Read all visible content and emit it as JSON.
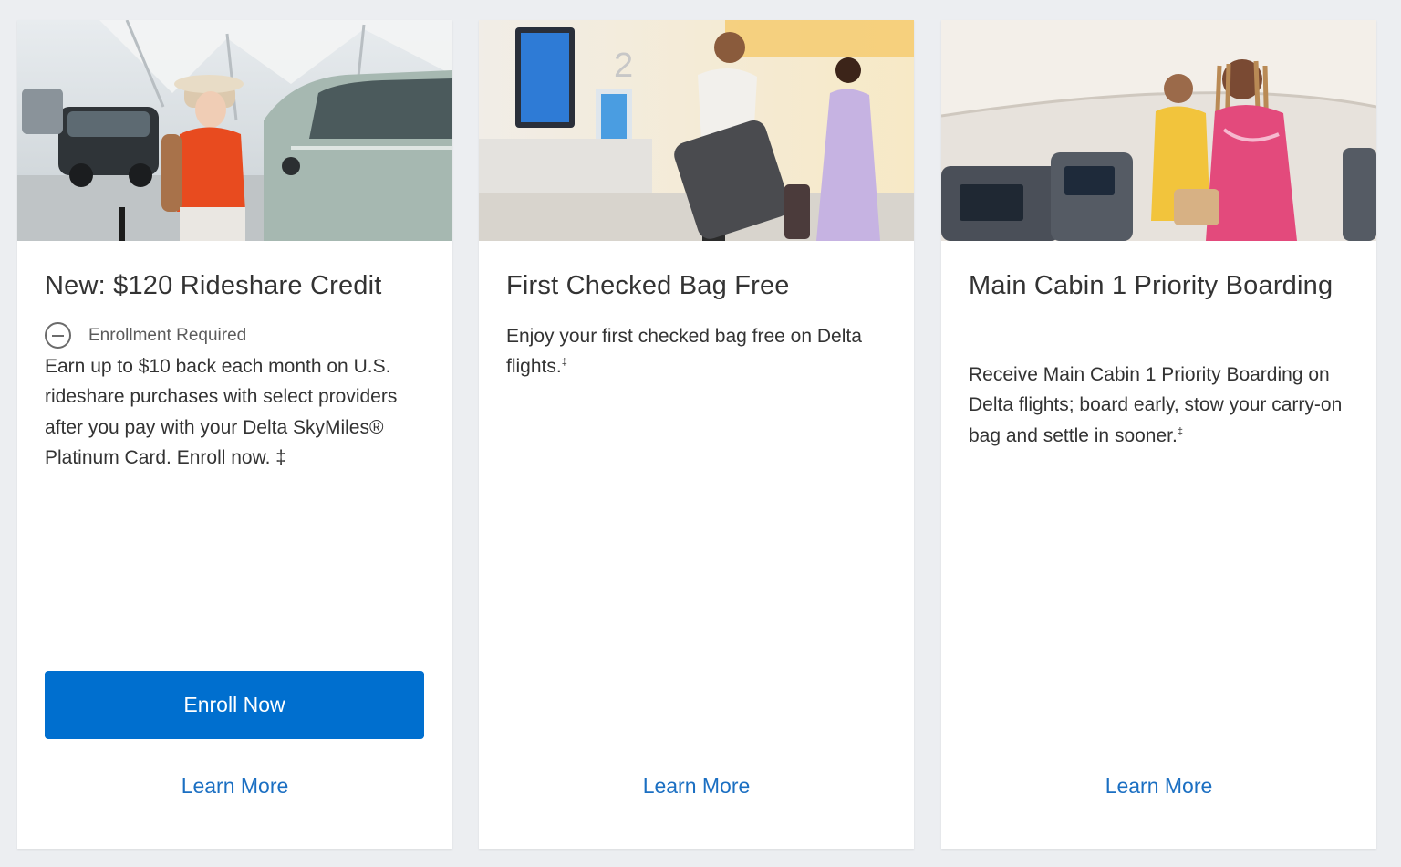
{
  "colors": {
    "page_background": "#eceef1",
    "card_background": "#ffffff",
    "primary_button": "#006fcf",
    "link": "#1b6fc2",
    "text": "#333333"
  },
  "cards": [
    {
      "image": "woman-with-luggage-by-car-photo",
      "title": "New: $120 Rideshare Credit",
      "badge": {
        "icon": "minus-circle-icon",
        "text": "Enrollment Required"
      },
      "description": "Earn up to $10 back each month on U.S. rideshare purchases with select providers after you pay with your Delta SkyMiles® Platinum Card. Enroll now. ‡",
      "button_label": "Enroll Now",
      "link_label": "Learn More"
    },
    {
      "image": "couple-with-suitcase-at-airport-photo",
      "title": "First Checked Bag Free",
      "description": "Enjoy your first checked bag free on Delta flights.",
      "footnote_mark": "‡",
      "link_label": "Learn More"
    },
    {
      "image": "women-boarding-airplane-cabin-photo",
      "title": "Main Cabin 1 Priority Boarding",
      "description": "Receive Main Cabin 1 Priority Boarding on Delta flights; board early, stow your carry-on bag and settle in sooner.",
      "footnote_mark": "‡",
      "link_label": "Learn More"
    }
  ]
}
